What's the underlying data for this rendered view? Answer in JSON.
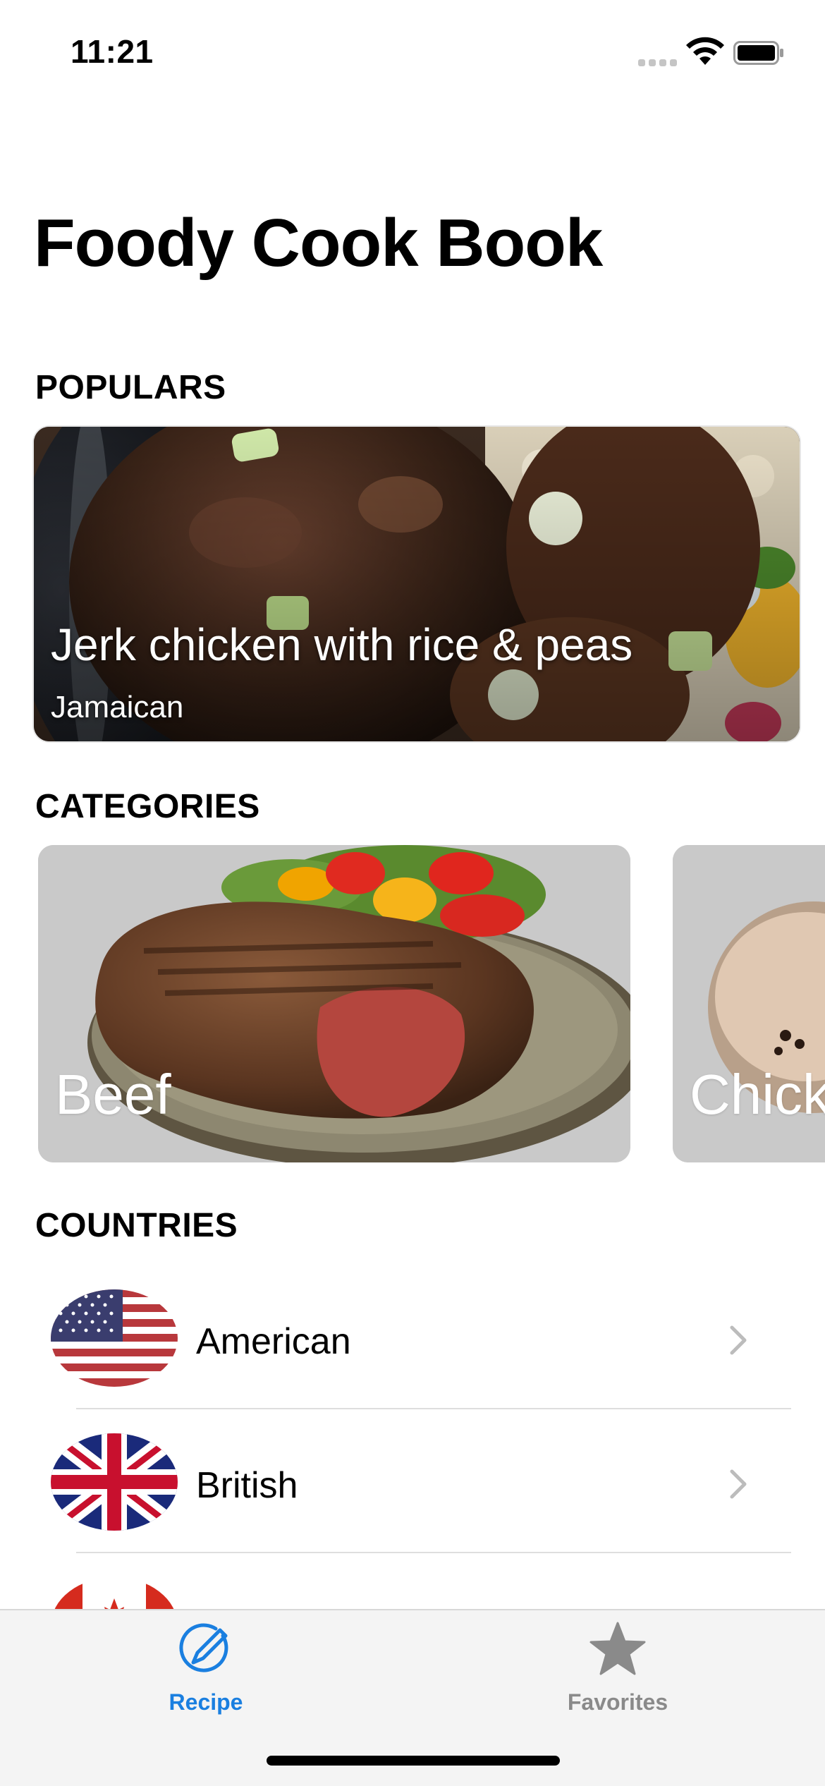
{
  "status_bar": {
    "time": "11:21"
  },
  "page_title": "Foody Cook Book",
  "populars": {
    "header": "POPULARS",
    "card": {
      "title": "Jerk chicken with rice & peas",
      "subtitle": "Jamaican"
    }
  },
  "categories": {
    "header": "CATEGORIES",
    "items": [
      {
        "label": "Beef"
      },
      {
        "label": "Chick"
      }
    ]
  },
  "countries": {
    "header": "COUNTRIES",
    "items": [
      {
        "name": "American",
        "flag": "us-flag"
      },
      {
        "name": "British",
        "flag": "uk-flag"
      },
      {
        "name": "",
        "flag": "canada-flag"
      }
    ]
  },
  "tab_bar": {
    "tabs": [
      {
        "label": "Recipe",
        "icon": "recipe-icon",
        "active": true
      },
      {
        "label": "Favorites",
        "icon": "star-icon",
        "active": false
      }
    ],
    "active_color": "#1a7fe0",
    "inactive_color": "#8a8a8a"
  }
}
